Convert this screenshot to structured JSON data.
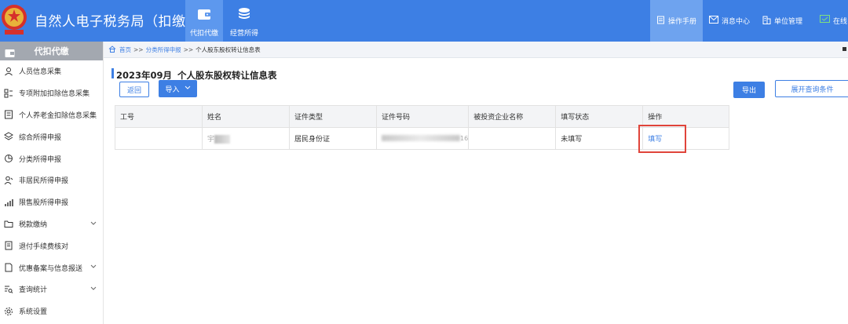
{
  "header": {
    "app_title": "自然人电子税务局（扣缴端）",
    "tabs": [
      {
        "label": "代扣代缴",
        "icon": "wallet-icon",
        "active": true
      },
      {
        "label": "经营所得",
        "icon": "coins-icon",
        "active": false
      }
    ],
    "right_menu": [
      {
        "label": "操作手册",
        "icon": "manual-icon"
      },
      {
        "label": "消息中心",
        "icon": "mail-icon"
      },
      {
        "label": "单位管理",
        "icon": "building-icon"
      },
      {
        "label": "在线",
        "icon": "chat-icon"
      }
    ]
  },
  "sidebar": {
    "title": "代扣代缴",
    "items": [
      {
        "label": "人员信息采集",
        "icon": "user-icon",
        "has_children": false
      },
      {
        "label": "专项附加扣除信息采集",
        "icon": "grid-list-icon",
        "has_children": false
      },
      {
        "label": "个人养老金扣除信息采集",
        "icon": "document-icon",
        "has_children": false
      },
      {
        "label": "综合所得申报",
        "icon": "layers-icon",
        "has_children": false
      },
      {
        "label": "分类所得申报",
        "icon": "pie-icon",
        "has_children": false
      },
      {
        "label": "非居民所得申报",
        "icon": "person-outline-icon",
        "has_children": false
      },
      {
        "label": "限售股所得申报",
        "icon": "bar-chart-icon",
        "has_children": false
      },
      {
        "label": "税款缴纳",
        "icon": "folder-icon",
        "has_children": true
      },
      {
        "label": "退付手续费核对",
        "icon": "receipt-icon",
        "has_children": false
      },
      {
        "label": "优惠备案与信息报送",
        "icon": "file-icon",
        "has_children": true
      },
      {
        "label": "查询统计",
        "icon": "search-list-icon",
        "has_children": true
      },
      {
        "label": "系统设置",
        "icon": "gear-icon",
        "has_children": false
      }
    ]
  },
  "breadcrumb": {
    "home": "首页",
    "sep": ">>",
    "level1": "分类所得申报",
    "current": "个人股东股权转让信息表"
  },
  "page": {
    "period": "2023年09月",
    "title": "个人股东股权转让信息表",
    "back_label": "返回",
    "import_label": "导入",
    "export_label": "导出",
    "expand_label": "展开查询条件"
  },
  "table": {
    "columns": [
      "工号",
      "姓名",
      "证件类型",
      "证件号码",
      "被投资企业名称",
      "填写状态",
      "操作"
    ],
    "rows": [
      {
        "emp_no": "",
        "name": "宇",
        "id_type": "居民身份证",
        "id_no_tail": "16",
        "company": "",
        "status": "未填写",
        "action": "填写"
      }
    ]
  },
  "colors": {
    "primary": "#3d7fe4",
    "sidebar_header": "#a3a8b0",
    "highlight_box": "#e0443a"
  }
}
